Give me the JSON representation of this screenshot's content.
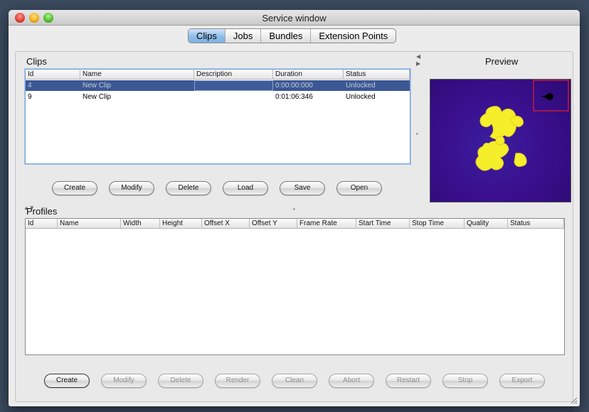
{
  "window": {
    "title": "Service window"
  },
  "tabs": [
    {
      "label": "Clips",
      "active": true
    },
    {
      "label": "Jobs",
      "active": false
    },
    {
      "label": "Bundles",
      "active": false
    },
    {
      "label": "Extension Points",
      "active": false
    }
  ],
  "clips": {
    "title": "Clips",
    "columns": [
      "Id",
      "Name",
      "Description",
      "Duration",
      "Status"
    ],
    "rows": [
      {
        "id": "4",
        "name": "New Clip",
        "description": "",
        "duration": "0:00:00:000",
        "status": "Unlocked",
        "selected": true
      },
      {
        "id": "9",
        "name": "New Clip",
        "description": "",
        "duration": "0:01:06:346",
        "status": "Unlocked",
        "selected": false
      }
    ],
    "buttons": [
      "Create",
      "Modify",
      "Delete",
      "Load",
      "Save",
      "Open"
    ]
  },
  "preview": {
    "title": "Preview"
  },
  "profiles": {
    "title": "Profiles",
    "columns": [
      "Id",
      "Name",
      "Width",
      "Height",
      "Offset X",
      "Offset Y",
      "Frame Rate",
      "Start Time",
      "Stop Time",
      "Quality",
      "Status"
    ],
    "buttons": [
      {
        "label": "Create",
        "enabled": true
      },
      {
        "label": "Modify",
        "enabled": false
      },
      {
        "label": "Delete",
        "enabled": false
      },
      {
        "label": "Render",
        "enabled": false
      },
      {
        "label": "Clean",
        "enabled": false
      },
      {
        "label": "Abort",
        "enabled": false
      },
      {
        "label": "Restart",
        "enabled": false
      },
      {
        "label": "Stop",
        "enabled": false
      },
      {
        "label": "Export",
        "enabled": false
      }
    ]
  },
  "colors": {
    "selection": "#3b5894",
    "tab_active": "#8fbde9",
    "preview_bg": "#3a0f8d",
    "fractal": "#f5ee2a",
    "zoom_frame": "#e0202a"
  }
}
